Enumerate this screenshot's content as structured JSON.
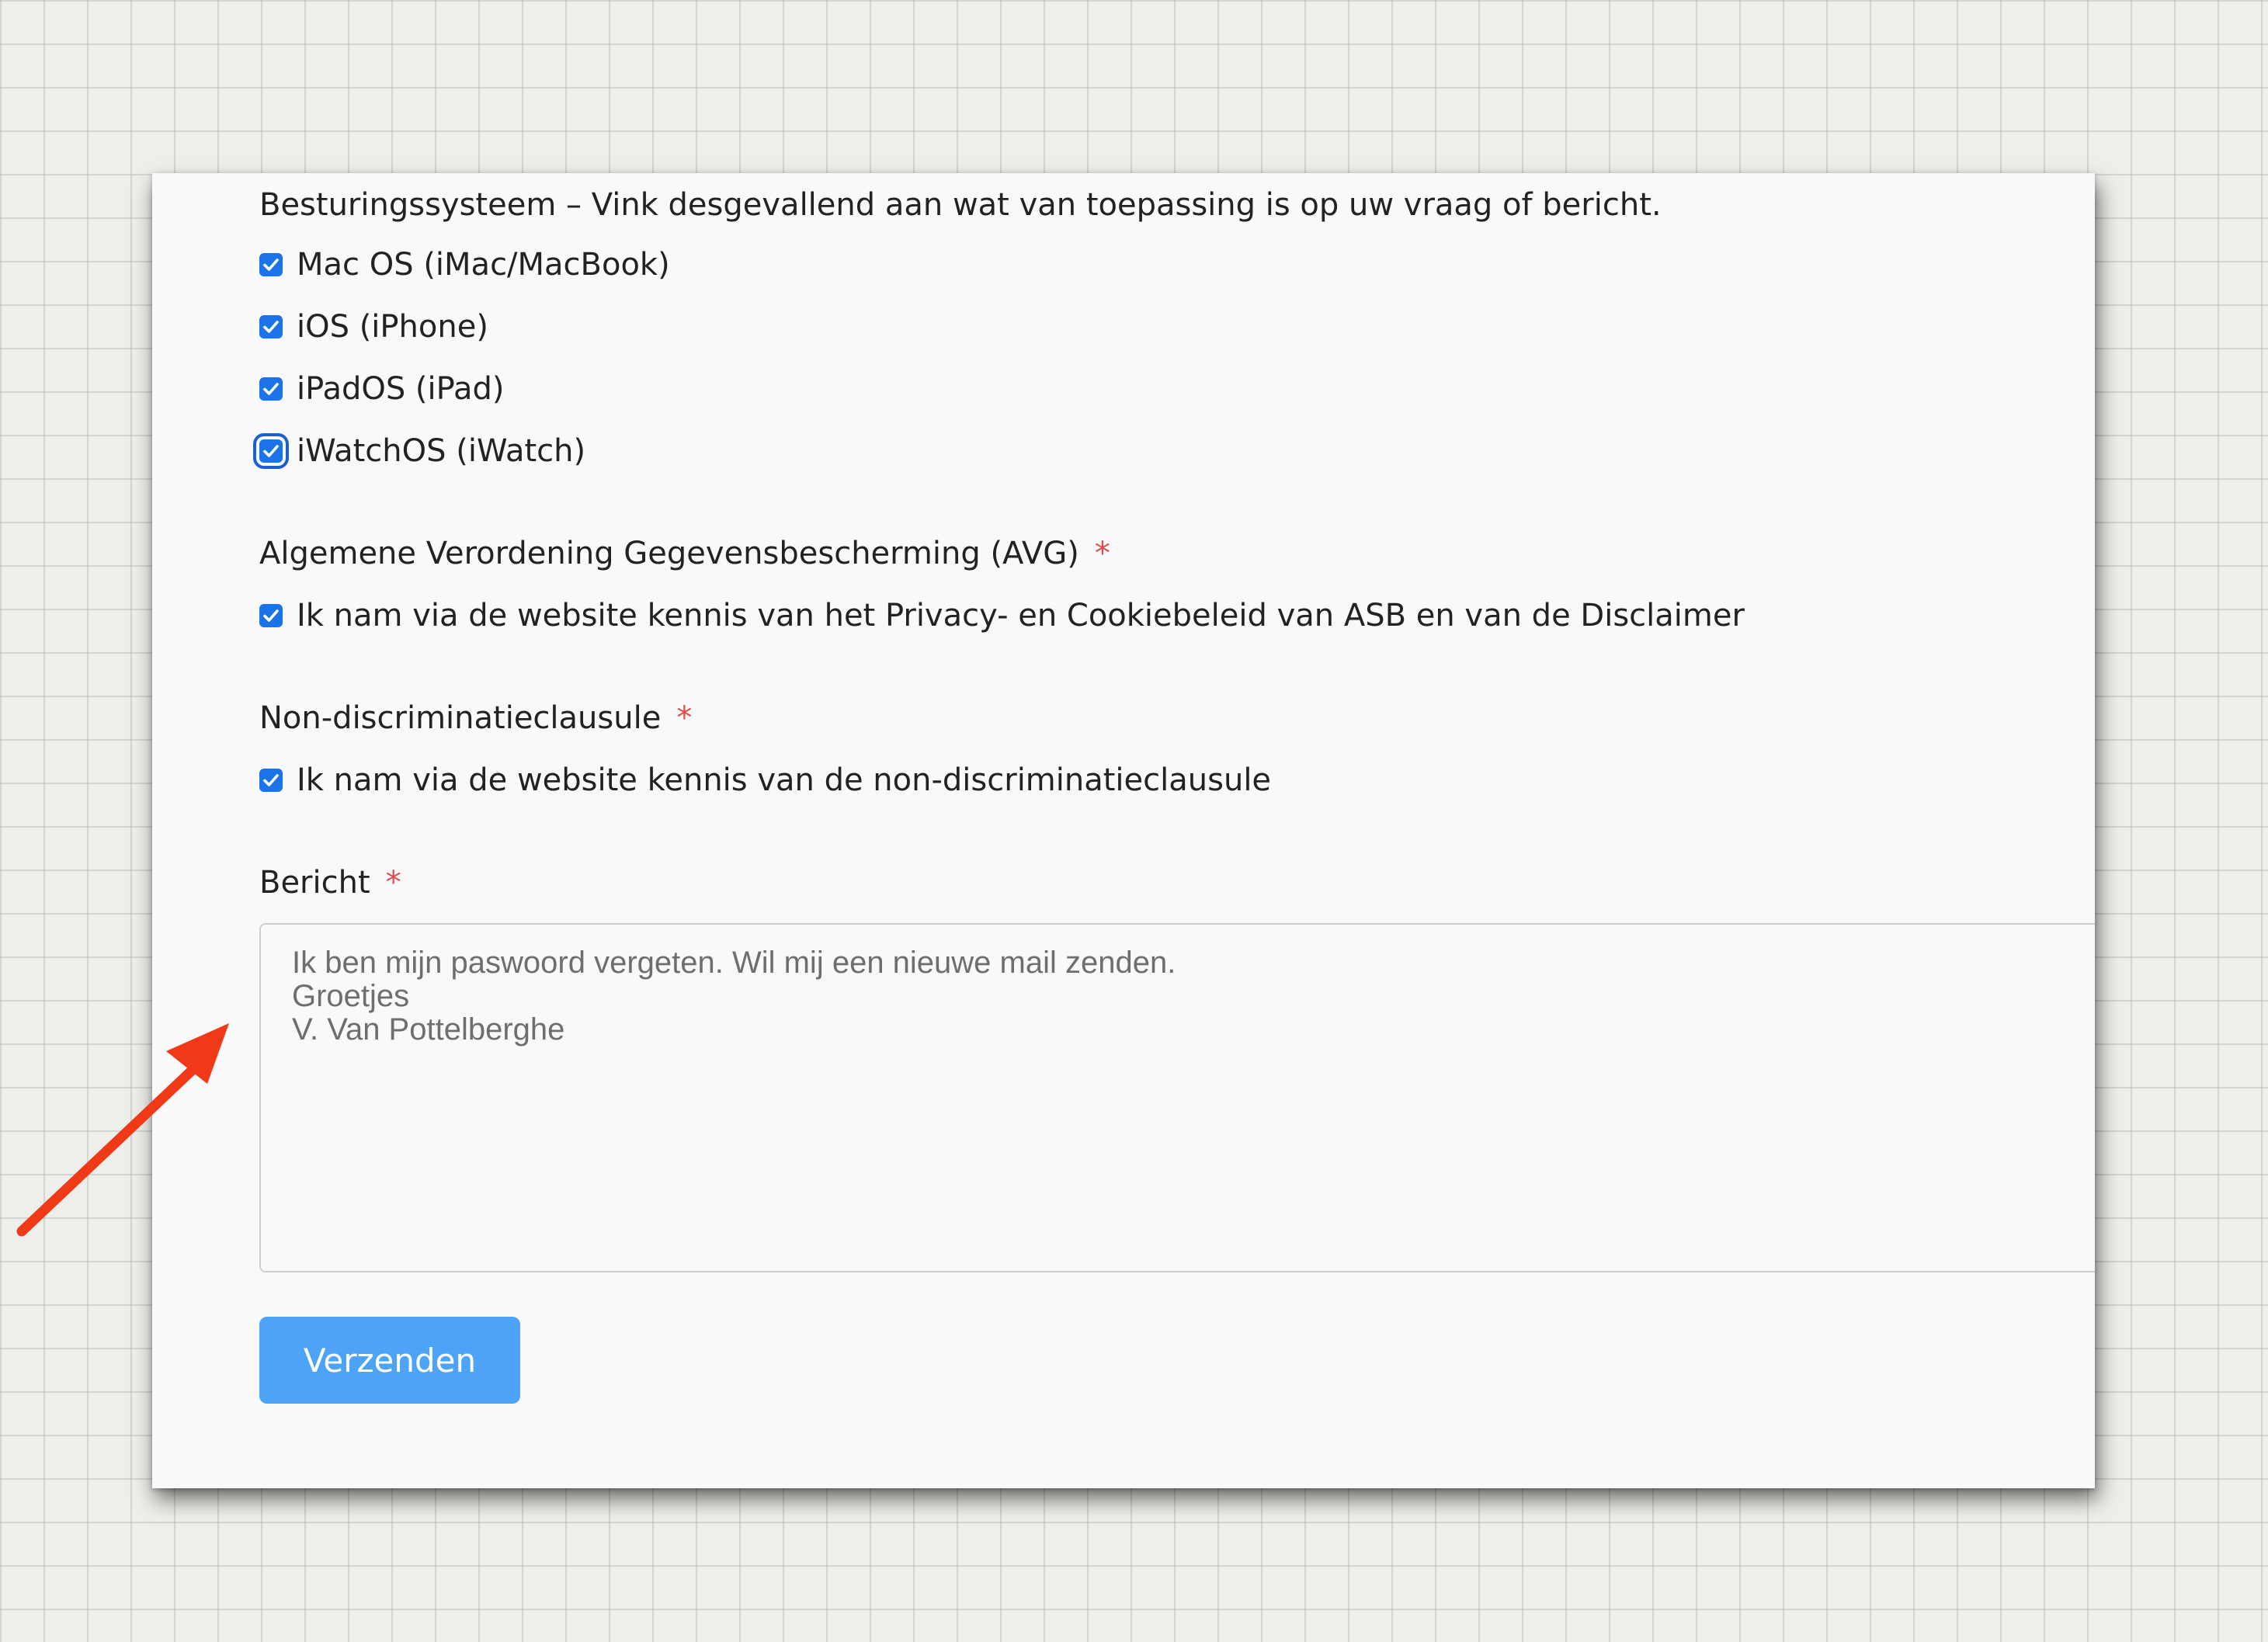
{
  "os_section": {
    "label": "Besturingssysteem – Vink desgevallend aan wat van toepassing is op uw vraag of bericht.",
    "options": [
      {
        "label": "Mac OS (iMac/MacBook)",
        "checked": true
      },
      {
        "label": "iOS (iPhone)",
        "checked": true
      },
      {
        "label": "iPadOS (iPad)",
        "checked": true
      },
      {
        "label": "iWatchOS (iWatch)",
        "checked": true,
        "focused": true
      }
    ]
  },
  "avg_section": {
    "label": "Algemene Verordening Gegevensbescherming (AVG)",
    "required_mark": "*",
    "checkbox_label": "Ik nam via de website kennis van het Privacy- en Cookiebeleid van ASB en van de Disclaimer",
    "checked": true
  },
  "nondiscrimination_section": {
    "label": "Non-discriminatieclausule",
    "required_mark": "*",
    "checkbox_label": "Ik nam via de website kennis van de non-discriminatieclausule",
    "checked": true
  },
  "message_section": {
    "label": "Bericht",
    "required_mark": "*",
    "lines": [
      "Ik ben mijn paswoord vergeten. Wil mij een nieuwe mail zenden.",
      "Groetjes",
      "V. Van Pottelberghe"
    ]
  },
  "submit_button": {
    "label": "Verzenden"
  },
  "colors": {
    "checkbox": "#1a73e8",
    "button": "#4da3f5",
    "required": "#e24b4b",
    "annotation_arrow": "#f03a17"
  }
}
